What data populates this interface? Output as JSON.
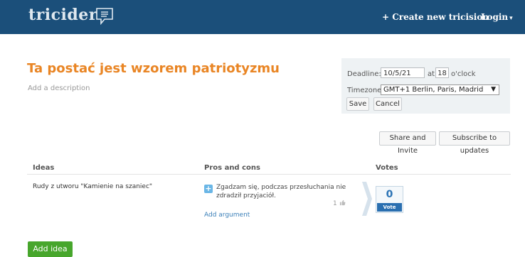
{
  "header": {
    "logo_text": "tricider",
    "create_link": "+ Create new tricision",
    "login_link": "Login",
    "login_caret": "▾"
  },
  "main": {
    "title": "Ta postać jest wzorem patriotyzmu",
    "description_placeholder": "Add a description"
  },
  "deadline": {
    "deadline_label": "Deadline:",
    "date_value": "10/5/21",
    "at_label": "at",
    "hour_value": "18",
    "oclock_label": "o'clock",
    "timezone_label": "Timezone:",
    "timezone_value": "GMT+1 Berlin, Paris, Madrid",
    "save_label": "Save",
    "cancel_label": "Cancel"
  },
  "actions": {
    "share_label": "Share and Invite",
    "subscribe_label": "Subscribe to updates"
  },
  "table": {
    "headers": [
      "Ideas",
      "Pros and cons",
      "Votes"
    ],
    "rows": [
      {
        "idea": "Rudy z utworu \"Kamienie na szaniec\"",
        "pro_text": "Zgadzam się, podczas przesłuchania nie zdradził przyjaciół.",
        "pro_likes": "1",
        "add_argument": "Add argument",
        "votes": "0",
        "vote_label": "Vote"
      }
    ]
  },
  "add_idea_label": "Add idea",
  "colors": {
    "header_bg": "#1b4f7a",
    "title": "#e98524",
    "add_idea": "#47a62c",
    "vote": "#2a6fb0",
    "link": "#3a7fb8"
  }
}
